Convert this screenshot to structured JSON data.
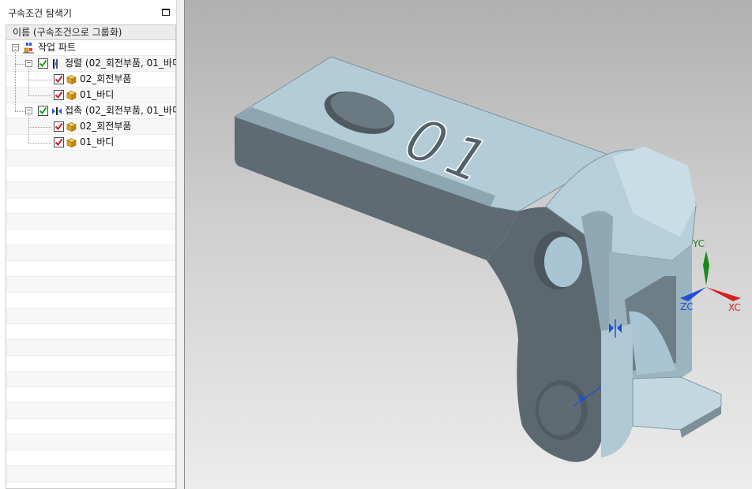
{
  "panel": {
    "title": "구속조건 탐색기",
    "column_header": "이름 (구속조건으로 그룹화)"
  },
  "tree": {
    "root": {
      "label": "작업 파트",
      "icon": "assembly-root-icon"
    },
    "groups": [
      {
        "label": "정렬 (02_회전부품, 01_바디",
        "checked": true,
        "icon": "align-constraint-icon",
        "children": [
          {
            "label": "02_회전부품",
            "checked": true,
            "icon": "part-cube-icon"
          },
          {
            "label": "01_바디",
            "checked": true,
            "icon": "part-cube-icon"
          }
        ]
      },
      {
        "label": "접촉 (02_회전부품, 01_바디",
        "checked": true,
        "icon": "touch-constraint-icon",
        "children": [
          {
            "label": "02_회전부품",
            "checked": true,
            "icon": "part-cube-icon"
          },
          {
            "label": "01_바디",
            "checked": true,
            "icon": "part-cube-icon"
          }
        ]
      }
    ]
  },
  "viewport": {
    "engraved_text": "01",
    "axes": {
      "y": "YC",
      "z": "ZC",
      "x": "XC"
    },
    "colors": {
      "y": "#1a8a1a",
      "z": "#1f4fd6",
      "x": "#d42222",
      "part": "#a9c4d2"
    }
  }
}
